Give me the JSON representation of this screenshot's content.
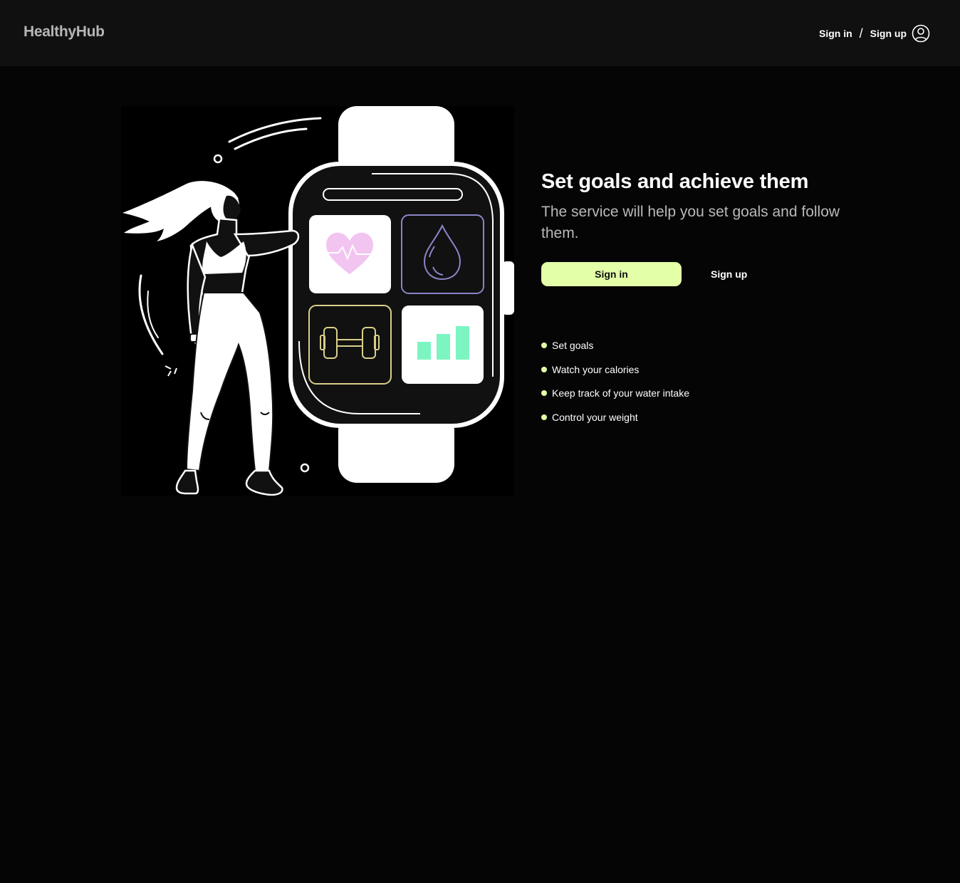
{
  "header": {
    "logo": "HealthyHub",
    "sign_in": "Sign in",
    "separator": "/",
    "sign_up": "Sign up",
    "user_icon": "user-circle-icon"
  },
  "hero": {
    "title": "Set goals and achieve them",
    "subtitle": "The service will help you set goals and follow them.",
    "sign_in_button": "Sign in",
    "sign_up_button": "Sign up",
    "features": [
      "Set goals",
      "Watch your calories",
      "Keep track of your water intake",
      "Control your weight"
    ]
  },
  "colors": {
    "accent": "#e3ffa8",
    "background": "#050505",
    "header": "#101010",
    "heart": "#f2c4f0",
    "chart": "#7cf5c2",
    "drop_outline": "#8a86c9",
    "dumbbell_outline": "#d9cf8a"
  }
}
